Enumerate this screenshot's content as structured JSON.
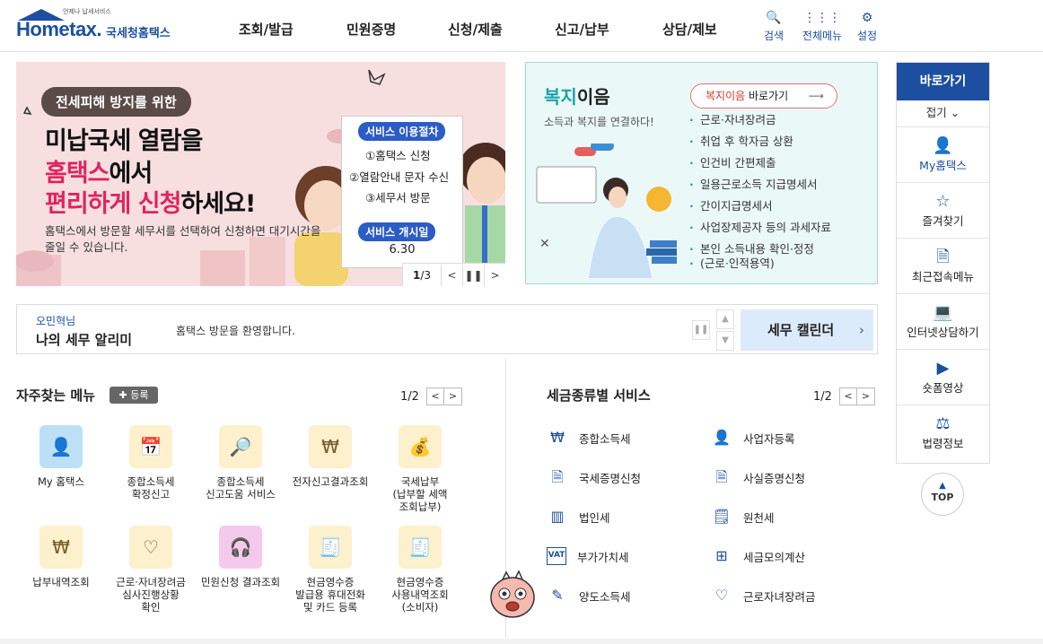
{
  "header": {
    "logo_small": "언제나 납세서비스",
    "logo_main": "Hometax.",
    "logo_sub": "국세청홈택스",
    "nav": [
      "조회/발급",
      "민원증명",
      "신청/제출",
      "신고/납부",
      "상담/제보"
    ],
    "util": [
      {
        "label": "검색",
        "icon": "search-icon"
      },
      {
        "label": "전체메뉴",
        "icon": "grid-icon"
      },
      {
        "label": "설정",
        "icon": "gear-icon"
      }
    ]
  },
  "banner": {
    "pill": "전세피해 방지를 위한",
    "line1": "미납국세 열람을",
    "line2a": "홈택스",
    "line2b": "에서",
    "line3a": "편리하게 신청",
    "line3b": "하세요!",
    "desc": "홈택스에서 방문할 세무서를 선택하여 신청하면 대기시간을 줄일 수 있습니다.",
    "proc_title": "서비스 이용절차",
    "steps": [
      "①홈택스 신청",
      "②열람안내 문자 수신",
      "③세무서 방문"
    ],
    "start_title": "서비스 개시일",
    "start_date": "6.30",
    "pager_current": "1",
    "pager_total": "/3",
    "colors": {
      "accent": "#e0245e",
      "bg": "#f7dfe0"
    }
  },
  "welfare": {
    "title_a": "복지",
    "title_b": "이음",
    "sub": "소득과 복지를 연결하다!",
    "link_red": "복지이음",
    "link_rest": " 바로가기",
    "items": [
      "근로·자녀장려금",
      "취업 후 학자금 상환",
      "인건비 간편제출",
      "일용근로소득 지급명세서",
      "간이지급명세서",
      "사업장제공자 등의 과세자료",
      "본인 소득내용 확인·정정",
      "(근로·인적용역)"
    ]
  },
  "quick": {
    "head": "바로가기",
    "fold": "접기 ⌄",
    "items": [
      {
        "label": "My홈택스",
        "icon": "user-icon"
      },
      {
        "label": "즐겨찾기",
        "icon": "star-icon"
      },
      {
        "label": "최근접속메뉴",
        "icon": "recent-icon"
      },
      {
        "label": "인터넷상담하기",
        "icon": "laptop-icon"
      },
      {
        "label": "숏폼영상",
        "icon": "play-icon"
      },
      {
        "label": "법령정보",
        "icon": "gavel-icon"
      }
    ],
    "top": "TOP"
  },
  "notice": {
    "user": "오민혁님",
    "title": "나의 세무 알리미",
    "message": "홈택스 방문을 환영합니다.",
    "calendar": "세무 캘린더"
  },
  "freq": {
    "title": "자주찾는 메뉴",
    "register": "✚ 등록",
    "page": "1/2",
    "items": [
      {
        "label": "My 홈택스",
        "icon": "user-icon",
        "style": "blue"
      },
      {
        "label": "종합소득세\n확정신고",
        "icon": "calendar-icon",
        "style": "yellow"
      },
      {
        "label": "종합소득세\n신고도움 서비스",
        "icon": "document-search-icon",
        "style": "yellow"
      },
      {
        "label": "전자신고결과조회",
        "icon": "won-search-icon",
        "style": "yellow"
      },
      {
        "label": "국세납부\n(납부할 세액\n조회납부)",
        "icon": "money-bag-icon",
        "style": "yellow"
      },
      {
        "label": "납부내역조회",
        "icon": "won-doc-icon",
        "style": "yellow"
      },
      {
        "label": "근로·자녀장려금\n심사진행상황\n확인",
        "icon": "heart-search-icon",
        "style": "yellow"
      },
      {
        "label": "민원신청 결과조회",
        "icon": "headset-icon",
        "style": "pink"
      },
      {
        "label": "현금영수증\n발급용 휴대전화\n및 카드 등록",
        "icon": "receipt-icon",
        "style": "yellow"
      },
      {
        "label": "현금영수증\n사용내역조회\n(소비자)",
        "icon": "receipt-search-icon",
        "style": "yellow"
      }
    ]
  },
  "taxsvc": {
    "title": "세금종류별 서비스",
    "page": "1/2",
    "left": [
      {
        "label": "종합소득세",
        "icon": "money-hand-icon"
      },
      {
        "label": "국세증명신청",
        "icon": "document-icon"
      },
      {
        "label": "법인세",
        "icon": "building-icon"
      },
      {
        "label": "부가가치세",
        "icon": "vat-icon"
      },
      {
        "label": "양도소득세",
        "icon": "transfer-icon"
      }
    ],
    "right": [
      {
        "label": "사업자등록",
        "icon": "user-icon"
      },
      {
        "label": "사실증명신청",
        "icon": "document-icon"
      },
      {
        "label": "원천세",
        "icon": "tax-doc-icon"
      },
      {
        "label": "세금모의계산",
        "icon": "calculator-icon"
      },
      {
        "label": "근로자녀장려금",
        "icon": "heart-hand-icon"
      }
    ]
  }
}
